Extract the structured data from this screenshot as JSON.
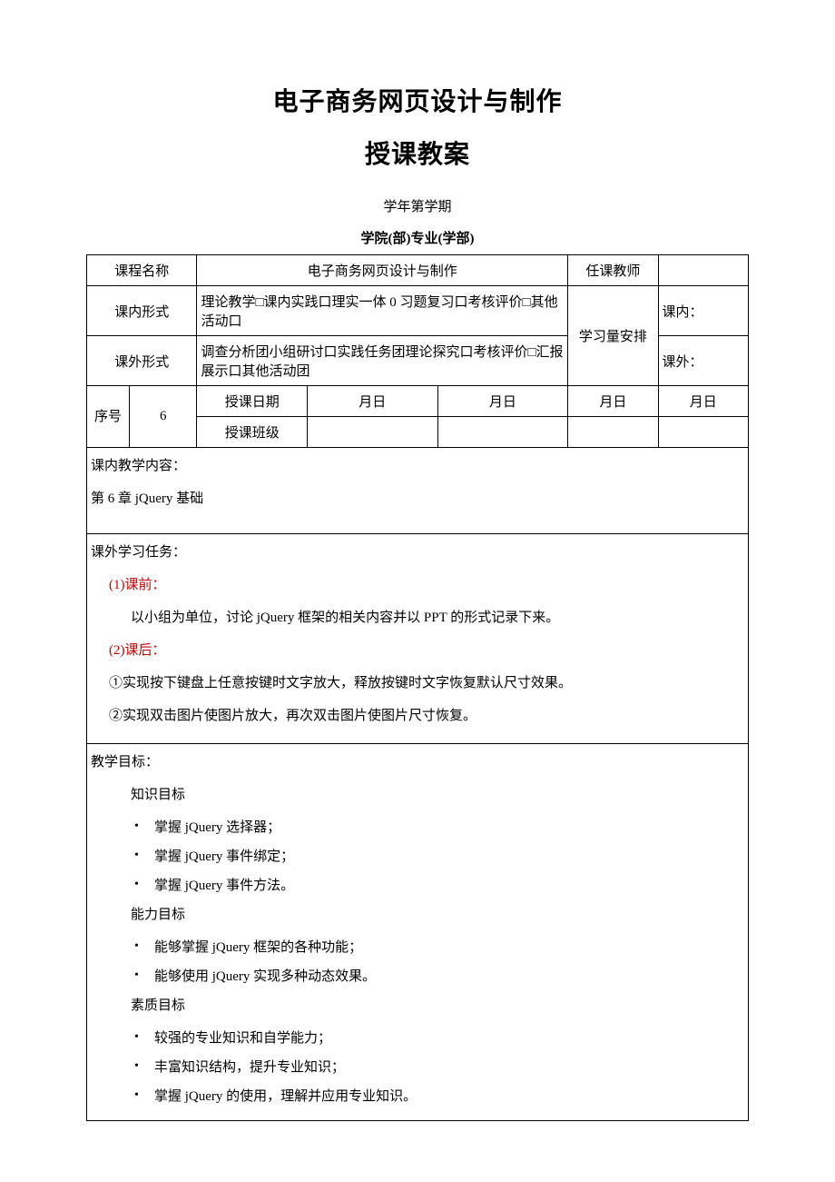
{
  "header": {
    "title_main": "电子商务网页设计与制作",
    "title_sub": "授课教案",
    "semester": "学年第学期",
    "college": "学院(部)专业(学部)"
  },
  "table": {
    "course_name_label": "课程名称",
    "course_name_value": "电子商务网页设计与制作",
    "instructor_label": "任课教师",
    "instructor_value": "",
    "inclass_form_label": "课内形式",
    "inclass_form_value": "理论教学□课内实践口理实一体 0 习题复习口考核评价□其他活动口",
    "study_arrange_label": "学习量安排",
    "inclass_label": "课内：",
    "outclass_form_label": "课外形式",
    "outclass_form_value": "调查分析团小组研讨口实践任务团理论探究口考核评价□汇报展示口其他活动团",
    "outclass_label": "课外：",
    "seq_label": "序号",
    "seq_value": "6",
    "teach_date_label": "授课日期",
    "month_day": "月日",
    "teach_class_label": "授课班级"
  },
  "content_a": {
    "heading": "课内教学内容：",
    "line1": "第 6 章 jQuery 基础"
  },
  "content_b": {
    "heading": "课外学习任务：",
    "pre_label": "(1)课前：",
    "pre_text": "以小组为单位，讨论 jQuery 框架的相关内容并以 PPT 的形式记录下来。",
    "post_label": "(2)课后：",
    "post_item1": "①实现按下键盘上任意按键时文字放大，释放按键时文字恢复默认尺寸效果。",
    "post_item2": "②实现双击图片使图片放大，再次双击图片使图片尺寸恢复。"
  },
  "content_c": {
    "heading": "教学目标：",
    "knowledge_label": "知识目标",
    "knowledge_items": [
      "掌握 jQuery 选择器；",
      "掌握 jQuery 事件绑定；",
      "掌握 jQuery 事件方法。"
    ],
    "ability_label": "能力目标",
    "ability_items": [
      "能够掌握 jQuery 框架的各种功能；",
      "能够使用 jQuery 实现多种动态效果。"
    ],
    "quality_label": "素质目标",
    "quality_items": [
      "较强的专业知识和自学能力；",
      "丰富知识结构，提升专业知识；",
      "掌握 jQuery 的使用，理解并应用专业知识。"
    ]
  }
}
